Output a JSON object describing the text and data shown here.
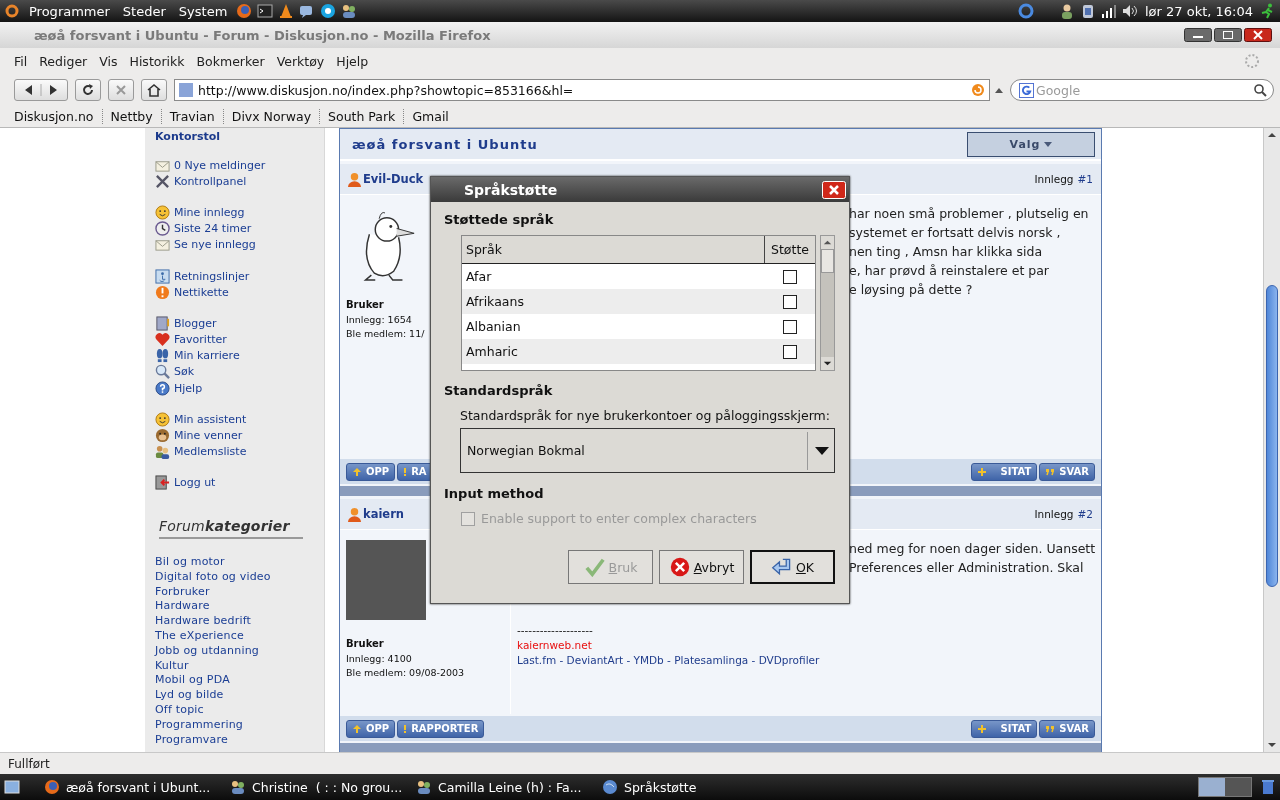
{
  "top_panel": {
    "menus": [
      "Programmer",
      "Steder",
      "System"
    ],
    "clock": "lør 27 okt, 16:04"
  },
  "window": {
    "title": "æøå forsvant i Ubuntu - Forum - Diskusjon.no - Mozilla Firefox"
  },
  "menu_bar": [
    "Fil",
    "Rediger",
    "Vis",
    "Historikk",
    "Bokmerker",
    "Verktøy",
    "Hjelp"
  ],
  "address_bar": {
    "value": "http://www.diskusjon.no/index.php?showtopic=853166&hl="
  },
  "search": {
    "placeholder": "Google"
  },
  "bookmarks": [
    "Diskusjon.no",
    "Nettby",
    "Travian",
    "Divx Norway",
    "South Park",
    "Gmail"
  ],
  "sidebar": {
    "user": "Kontorstol",
    "groups": [
      [
        "0 Nye meldinger",
        "Kontrollpanel"
      ],
      [
        "Mine innlegg",
        "Siste 24 timer",
        "Se nye innlegg"
      ],
      [
        "Retningslinjer",
        "Nettikette"
      ],
      [
        "Blogger",
        "Favoritter",
        "Min karriere",
        "Søk",
        "Hjelp"
      ],
      [
        "Min assistent",
        "Mine venner",
        "Medlemsliste"
      ],
      [
        "Logg ut"
      ]
    ],
    "categories_heading": "Forum**kategorier**",
    "categories": [
      "Bil og motor",
      "Digital foto og video",
      "Forbruker",
      "Hardware",
      "Hardware bedrift",
      "The eXperience",
      "Jobb og utdanning",
      "Kultur",
      "Mobil og PDA",
      "Lyd og bilde",
      "Off topic",
      "Programmering",
      "Programvare"
    ]
  },
  "topic": {
    "title": "æøå forsvant i Ubuntu",
    "options_button": "Valg"
  },
  "posts": [
    {
      "author": "Evil-Duck",
      "number_label": "Innlegg",
      "number": "#1",
      "role": "Bruker",
      "post_count": "Innlegg: 1654",
      "joined": "Ble medlem: 11/",
      "body": [
        "har noen små problemer , plutselig en",
        "systemet er fortsatt delvis norsk ,",
        "nen ting , Amsn har klikka sida",
        "e, har prøvd å reinstalere et par",
        "e løysing på dette ?"
      ],
      "footer_left": [
        "OPP",
        "RA"
      ],
      "footer_right": [
        "SITAT",
        "SVAR"
      ]
    },
    {
      "author": "kaiern",
      "number_label": "Innlegg",
      "number": "#2",
      "role": "Bruker",
      "post_count": "Innlegg: 4100",
      "joined": "Ble medlem: 09/08-2003",
      "body": [
        "ned meg for noen dager siden. Uansett",
        "Preferences eller Administration. Skal"
      ],
      "signature": {
        "rule": "--------------------",
        "site": "kaiernweb.net",
        "links": "Last.fm - DeviantArt - YMDb - Platesamlinga - DVDprofiler"
      },
      "footer_left": [
        "OPP",
        "RAPPORTER"
      ],
      "footer_right": [
        "SITAT",
        "SVAR"
      ]
    }
  ],
  "dialog": {
    "title": "Språkstøtte",
    "section_languages": "Støttede språk",
    "columns": [
      "Språk",
      "Støtte"
    ],
    "languages": [
      {
        "name": "Afar",
        "checked": false
      },
      {
        "name": "Afrikaans",
        "checked": false
      },
      {
        "name": "Albanian",
        "checked": false
      },
      {
        "name": "Amharic",
        "checked": false
      }
    ],
    "section_default": "Standardspråk",
    "default_label": "Standardspråk for nye brukerkontoer og påloggingsskjerm:",
    "default_language": "Norwegian Bokmal",
    "section_input": "Input method",
    "input_option": {
      "label": "Enable support to enter complex characters",
      "checked": false,
      "disabled": true
    },
    "buttons": [
      {
        "label": "Bruk",
        "kind": "apply",
        "disabled": true,
        "default": false
      },
      {
        "label": "Avbryt",
        "kind": "cancel",
        "disabled": false,
        "default": false
      },
      {
        "label": "OK",
        "kind": "ok",
        "disabled": false,
        "default": true
      }
    ]
  },
  "status_bar": "Fullført",
  "taskbar": [
    "æøå forsvant i Ubunt...",
    "Christine  ( : : No grou...",
    "Camilla Leine (h) : Fa...",
    "Språkstøtte"
  ]
}
